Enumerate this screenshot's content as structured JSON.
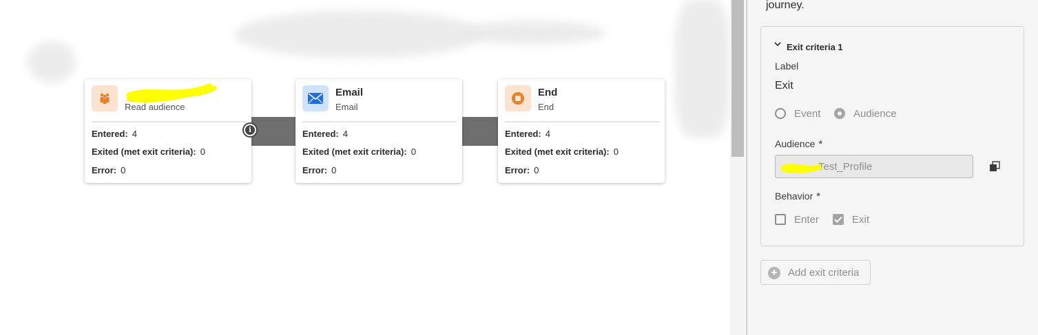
{
  "canvas": {
    "nodes": [
      {
        "title": "",
        "subtitle": "Read audience",
        "icon": "audience-people-icon",
        "stats": {
          "entered_label": "Entered:",
          "entered": "4",
          "exited_label": "Exited (met exit criteria):",
          "exited": "0",
          "error_label": "Error:",
          "error": "0"
        }
      },
      {
        "title": "Email",
        "subtitle": "Email",
        "icon": "envelope-icon",
        "stats": {
          "entered_label": "Entered:",
          "entered": "4",
          "exited_label": "Exited (met exit criteria):",
          "exited": "0",
          "error_label": "Error:",
          "error": "0"
        }
      },
      {
        "title": "End",
        "subtitle": "End",
        "icon": "stop-circle-icon",
        "stats": {
          "entered_label": "Entered:",
          "entered": "4",
          "exited_label": "Exited (met exit criteria):",
          "exited": "0",
          "error_label": "Error:",
          "error": "0"
        }
      }
    ]
  },
  "panel": {
    "description_tail": "journey.",
    "criteria": {
      "title": "Exit criteria 1",
      "label_label": "Label",
      "label_value": "Exit",
      "type_options": [
        "Event",
        "Audience"
      ],
      "type_selected": "Audience",
      "audience_label": "Audience",
      "audience_value": "Test_Profile",
      "behavior_label": "Behavior",
      "behavior_options": [
        "Enter",
        "Exit"
      ],
      "behavior_checked": [
        "Exit"
      ],
      "required_marker": "*"
    },
    "add_button_label": "Add exit criteria"
  },
  "colors": {
    "audience_icon_bg": "#fbe3cf",
    "audience_icon": "#e8822a",
    "email_icon_bg": "#cfe3fb",
    "email_icon": "#1e6fd9",
    "end_icon_bg": "#fbe3cf",
    "end_icon": "#e8822a",
    "highlight": "#ffff00"
  }
}
